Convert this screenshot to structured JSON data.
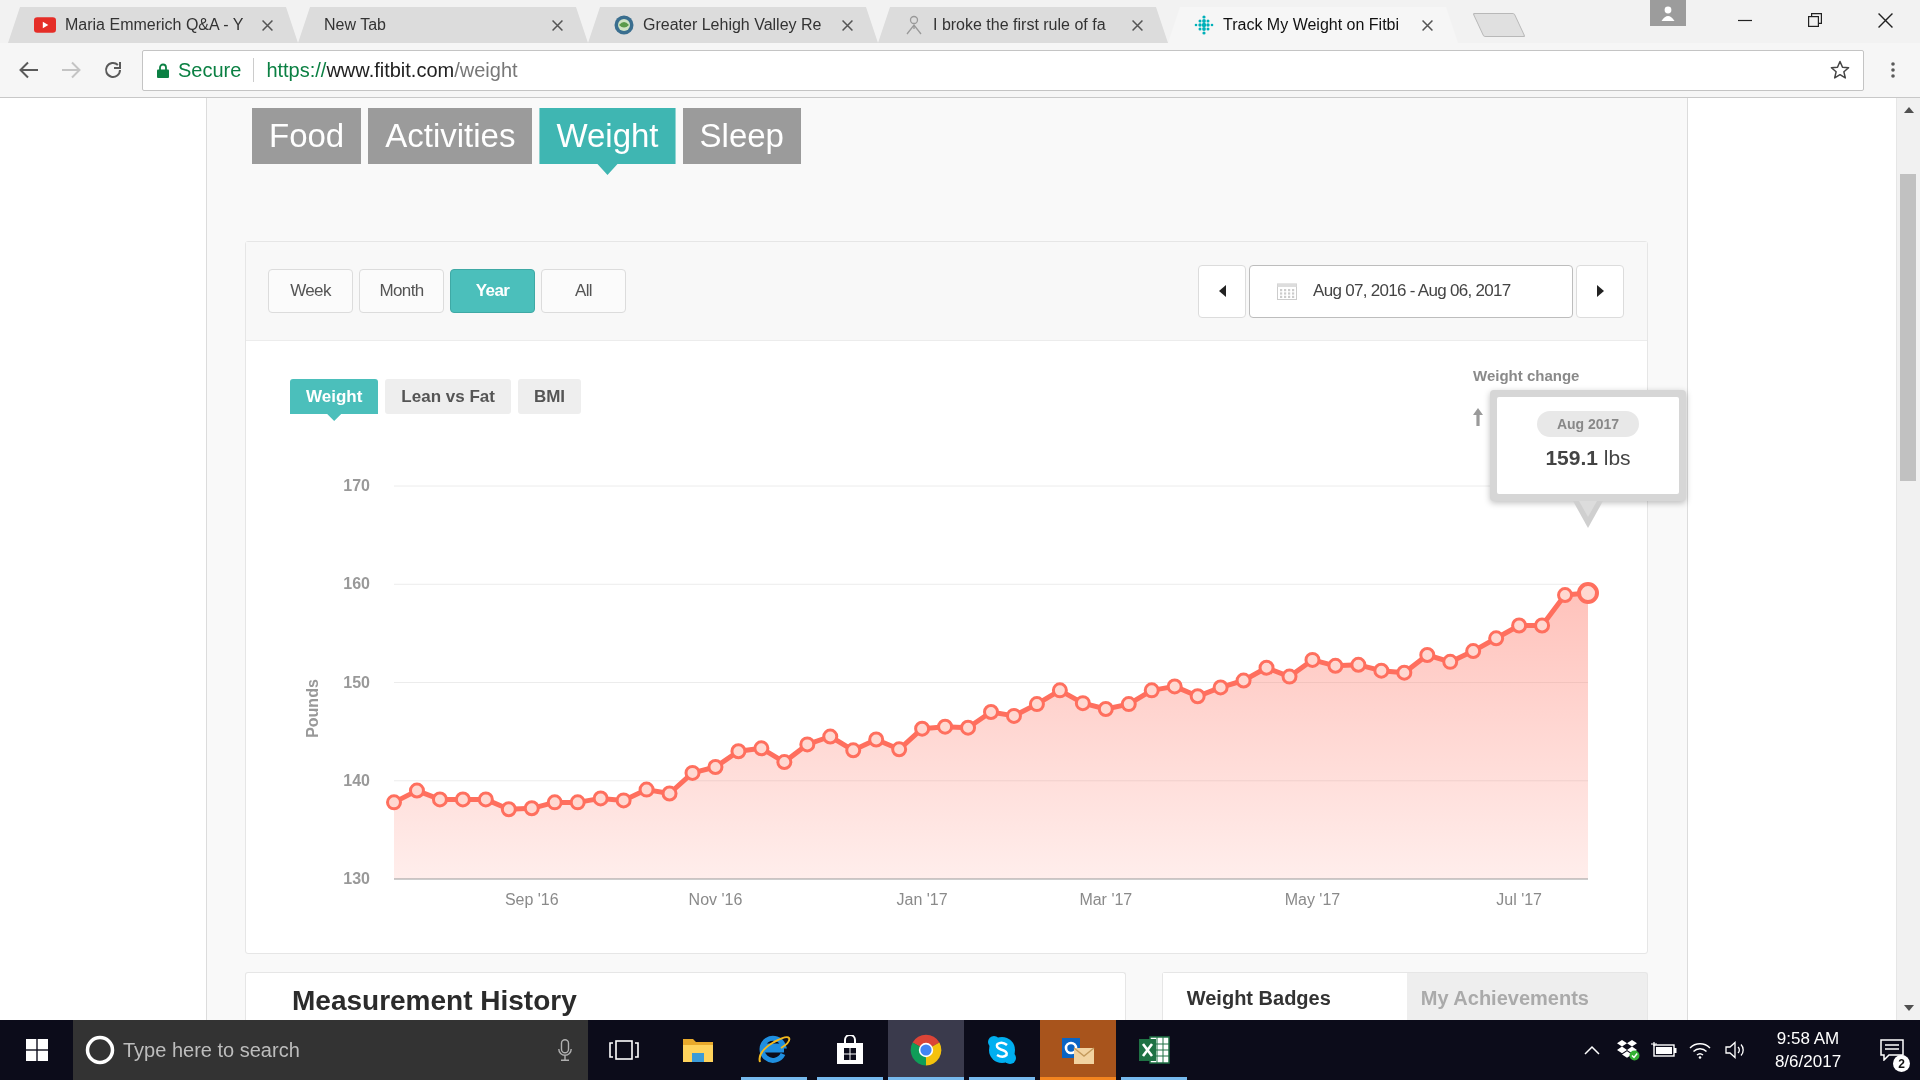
{
  "browser": {
    "tabs": [
      {
        "title": "Maria Emmerich Q&A - Y",
        "kind": "play",
        "selected": false
      },
      {
        "title": "New Tab",
        "selected": false
      },
      {
        "title": "Greater Lehigh Valley Re",
        "kind": "globe",
        "selected": false
      },
      {
        "title": "I broke the first rule of fa",
        "kind": "person",
        "selected": false
      },
      {
        "title": "Track My Weight on Fitbi",
        "kind": "dots",
        "selected": true
      }
    ],
    "address_bar": {
      "security": "Secure",
      "url": {
        "scheme": "https://",
        "host": "www.fitbit.com",
        "path": "/weight"
      }
    }
  },
  "nav_tabs": [
    {
      "label": "Food",
      "selected": false
    },
    {
      "label": "Activities",
      "selected": false
    },
    {
      "label": "Weight",
      "selected": true
    },
    {
      "label": "Sleep",
      "selected": false
    }
  ],
  "range_buttons": [
    {
      "label": "Week",
      "selected": false
    },
    {
      "label": "Month",
      "selected": false
    },
    {
      "label": "Year",
      "selected": true
    },
    {
      "label": "All",
      "selected": false
    }
  ],
  "date_range": "Aug 07, 2016 - Aug 06, 2017",
  "chart_tabs": [
    {
      "label": "Weight",
      "selected": true
    },
    {
      "label": "Lean vs Fat",
      "selected": false
    },
    {
      "label": "BMI",
      "selected": false
    }
  ],
  "weight_change_label": "Weight change",
  "chart_data": {
    "type": "area",
    "ylabel": "Pounds",
    "categories": [
      null,
      null,
      null,
      null,
      null,
      null,
      "Sep '16",
      null,
      null,
      null,
      null,
      null,
      null,
      null,
      "Nov '16",
      null,
      null,
      null,
      null,
      null,
      null,
      null,
      null,
      "Jan '17",
      null,
      null,
      null,
      null,
      null,
      null,
      null,
      "Mar '17",
      null,
      null,
      null,
      null,
      null,
      null,
      null,
      null,
      "May '17",
      null,
      null,
      null,
      null,
      null,
      null,
      null,
      null,
      "Jul '17",
      null,
      null,
      null
    ],
    "series": [
      {
        "color": "#ff6f5e",
        "values": [
          137.8,
          139.0,
          138.1,
          138.1,
          138.1,
          137.1,
          137.2,
          137.8,
          137.8,
          138.2,
          138.0,
          139.1,
          138.7,
          140.8,
          141.4,
          143.0,
          143.3,
          141.9,
          143.7,
          144.5,
          143.1,
          144.2,
          143.2,
          145.3,
          145.5,
          145.4,
          147.0,
          146.6,
          147.8,
          149.2,
          147.9,
          147.3,
          147.8,
          149.2,
          149.6,
          148.6,
          149.5,
          150.2,
          151.5,
          150.6,
          152.3,
          151.7,
          151.8,
          151.2,
          151.0,
          152.8,
          152.1,
          153.2,
          154.5,
          155.8,
          155.8,
          158.9,
          159.1
        ]
      }
    ],
    "ylim": [
      130,
      170
    ],
    "yticks": [
      130,
      140,
      150,
      160,
      170
    ],
    "grid": true
  },
  "tooltip": {
    "date": "Aug 2017",
    "value": "**159.1** lbs"
  },
  "measurement_history": {
    "title": "Measurement History"
  },
  "badge_tabs": [
    {
      "label": "Weight Badges",
      "selected": true
    },
    {
      "label": "My Achievements",
      "selected": false
    }
  ],
  "taskbar": {
    "search": {
      "placeholder": "Type here to search"
    },
    "apps": [
      {
        "kind": "folder",
        "running": false,
        "selected": false,
        "alert": false
      },
      {
        "kind": "e-logo",
        "running": true,
        "selected": false,
        "alert": false
      },
      {
        "kind": "bag",
        "running": true,
        "selected": false,
        "alert": false
      },
      {
        "kind": "ring-logo",
        "running": true,
        "selected": true,
        "alert": false
      },
      {
        "kind": "s-logo",
        "running": true,
        "selected": false,
        "alert": false
      },
      {
        "kind": "mail",
        "running": true,
        "selected": false,
        "alert": true
      },
      {
        "kind": "sheet",
        "running": true,
        "selected": false,
        "alert": false
      }
    ],
    "clock": {
      "time": "9:58 AM",
      "date": "8/6/2017"
    },
    "notifications": "2"
  }
}
